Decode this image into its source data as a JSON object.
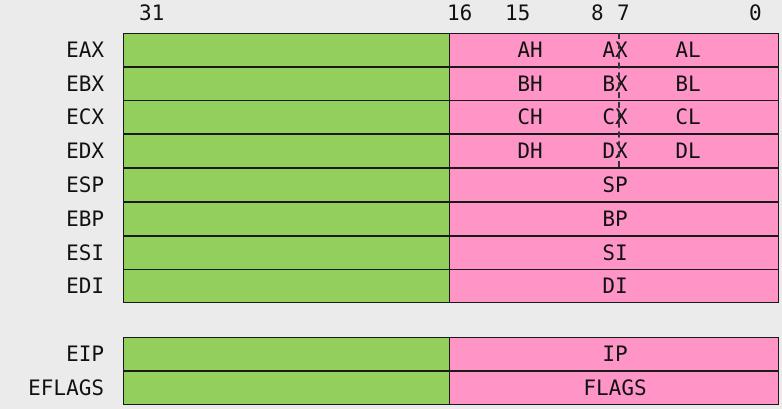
{
  "bit_labels": {
    "b31": "31",
    "b16": "16",
    "b15": "15",
    "b8": "8",
    "b7": "7",
    "b0": "0"
  },
  "general_registers": [
    {
      "name": "EAX",
      "low16": "AX",
      "high8": "AH",
      "low8": "AL"
    },
    {
      "name": "EBX",
      "low16": "BX",
      "high8": "BH",
      "low8": "BL"
    },
    {
      "name": "ECX",
      "low16": "CX",
      "high8": "CH",
      "low8": "CL"
    },
    {
      "name": "EDX",
      "low16": "DX",
      "high8": "DH",
      "low8": "DL"
    },
    {
      "name": "ESP",
      "low16": "SP"
    },
    {
      "name": "EBP",
      "low16": "BP"
    },
    {
      "name": "ESI",
      "low16": "SI"
    },
    {
      "name": "EDI",
      "low16": "DI"
    }
  ],
  "special_registers": [
    {
      "name": "EIP",
      "low16": "IP"
    },
    {
      "name": "EFLAGS",
      "low16": "FLAGS"
    }
  ],
  "colors": {
    "upper_half": "#92cf5c",
    "lower_half": "#ff94c6",
    "border": "#1a1a1a",
    "background": "#ebebeb"
  }
}
